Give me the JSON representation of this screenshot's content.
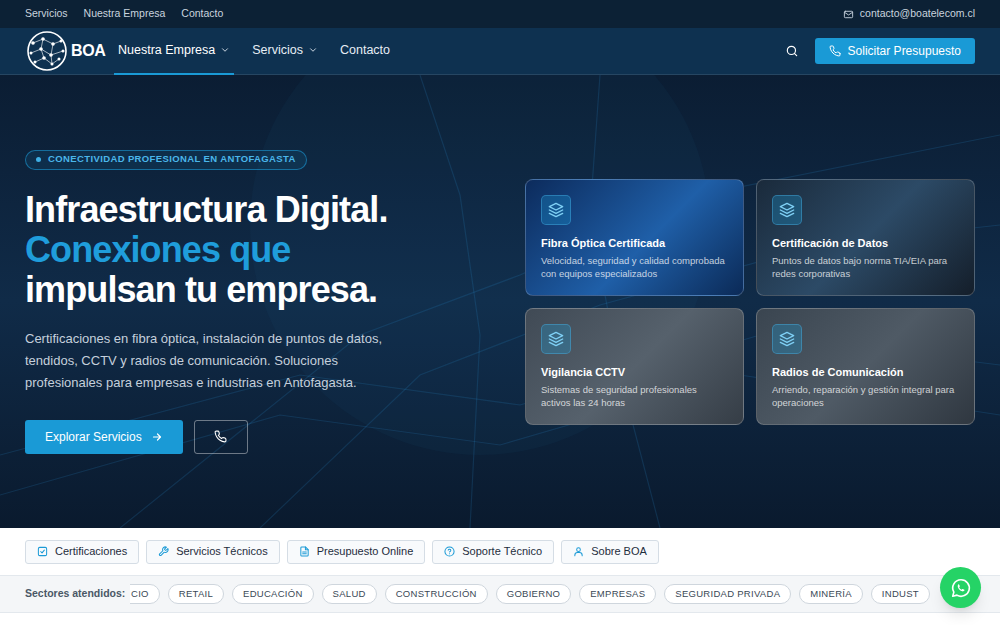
{
  "top_bar": {
    "links": [
      "Servicios",
      "Nuestra Empresa",
      "Contacto"
    ],
    "email": "contacto@boatelecom.cl"
  },
  "nav": {
    "logo": "BOA",
    "items": [
      {
        "label": "Nuestra Empresa",
        "selected": true,
        "dropdown": true
      },
      {
        "label": "Servicios",
        "selected": false,
        "dropdown": true
      },
      {
        "label": "Contacto",
        "selected": false,
        "dropdown": false
      }
    ],
    "cta": "Solicitar Presupuesto"
  },
  "hero": {
    "badge": "CONECTIVIDAD PROFESIONAL EN ANTOFAGASTA",
    "title_lines": [
      {
        "text": "Infraestructura Digital.",
        "highlighted": false
      },
      {
        "text": "Conexiones que",
        "highlighted": true
      },
      {
        "text": "impulsan tu empresa.",
        "highlighted": false
      }
    ],
    "description": "Certificaciones en fibra óptica, instalación de puntos de datos, tendidos, CCTV y radios de comunicación. Soluciones profesionales para empresas e industrias en Antofagasta.",
    "primary_button": "Explorar Servicios"
  },
  "service_cards": [
    {
      "title": "Fibra Óptica Certificada",
      "description": "Velocidad, seguridad y calidad comprobada con equipos especializados"
    },
    {
      "title": "Certificación de Datos",
      "description": "Puntos de datos bajo norma TIA/EIA para redes corporativas"
    },
    {
      "title": "Vigilancia CCTV",
      "description": "Sistemas de seguridad profesionales activos las 24 horas"
    },
    {
      "title": "Radios de Comunicación",
      "description": "Arriendo, reparación y gestión integral para operaciones"
    }
  ],
  "quick_links": [
    "Certificaciones",
    "Servicios Técnicos",
    "Presupuesto Online",
    "Soporte Técnico",
    "Sobre BOA"
  ],
  "sectors": {
    "label": "Sectores atendidos:",
    "items": [
      "CIO",
      "RETAIL",
      "EDUCACIÓN",
      "SALUD",
      "CONSTRUCCIÓN",
      "GOBIERNO",
      "EMPRESAS",
      "SEGURIDAD PRIVADA",
      "MINERÍA",
      "INDUST"
    ]
  }
}
